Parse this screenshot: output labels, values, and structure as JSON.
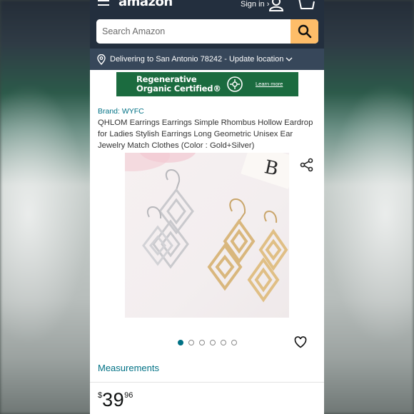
{
  "header": {
    "logo_text": "amazon",
    "signin_label": "Sign in ›",
    "cart_count": "0"
  },
  "search": {
    "placeholder": "Search Amazon"
  },
  "location": {
    "text": "Delivering to San Antonio 78242 - Update location"
  },
  "banner": {
    "title_line1": "Regenerative",
    "title_line2": "Organic Certified®",
    "link_label": "Learn more"
  },
  "product": {
    "brand": "Brand: WYFC",
    "title": "QHLOM Earrings Earrings Simple Rhombus Hollow Eardrop for Ladies Stylish Earrings Long Geometric Unisex Ear Jewelry Match Clothes (Color : Gold+Silver)",
    "image_count": 6,
    "active_image": 1,
    "measurements_label": "Measurements",
    "price_currency": "$",
    "price_whole": "39",
    "price_fraction": "96"
  },
  "colors": {
    "header_bg": "#232f3e",
    "location_bg": "#37475a",
    "search_button": "#febd69",
    "link": "#007185",
    "banner_bg": "#1b6b3f"
  },
  "icons": [
    "menu-icon",
    "user-icon",
    "cart-icon",
    "search-icon",
    "location-pin-icon",
    "chevron-down-icon",
    "share-icon",
    "heart-icon"
  ]
}
